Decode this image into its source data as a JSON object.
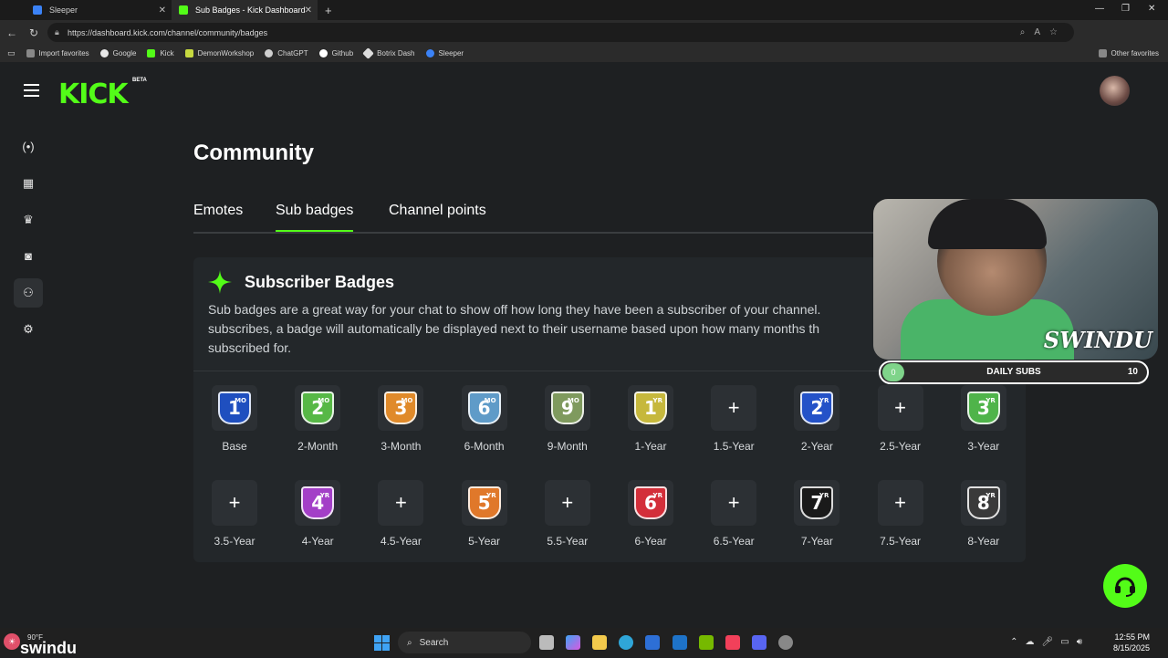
{
  "browser": {
    "tabs": [
      {
        "label": "Sleeper",
        "active": false
      },
      {
        "label": "Sub Badges - Kick Dashboard",
        "active": true
      }
    ],
    "url": "https://dashboard.kick.com/channel/community/badges",
    "bookmarks": [
      "Import favorites",
      "Google",
      "Kick",
      "DemonWorkshop",
      "ChatGPT",
      "Github",
      "Botrix Dash",
      "Sleeper"
    ],
    "other_favorites": "Other favorites"
  },
  "header": {
    "logo": "KICK",
    "beta": "BETA"
  },
  "page": {
    "title": "Community",
    "tabs": [
      {
        "label": "Emotes",
        "selected": false
      },
      {
        "label": "Sub badges",
        "selected": true
      },
      {
        "label": "Channel points",
        "selected": false
      }
    ]
  },
  "card": {
    "title": "Subscriber Badges",
    "desc_line1": "Sub badges are a great way for your chat to show off how long they have been a subscriber of your channel.",
    "desc_line2": "subscribes, a badge will automatically be displayed next to their username based upon how many months th",
    "desc_line3": "subscribed for."
  },
  "badges": [
    {
      "label": "Base",
      "num": "1",
      "unit": "MO",
      "color": "#1f4fbf",
      "set": true
    },
    {
      "label": "2-Month",
      "num": "2",
      "unit": "MO",
      "color": "#57b846",
      "set": true
    },
    {
      "label": "3-Month",
      "num": "3",
      "unit": "MO",
      "color": "#e08a2a",
      "set": true
    },
    {
      "label": "6-Month",
      "num": "6",
      "unit": "MO",
      "color": "#5f9bc8",
      "set": true
    },
    {
      "label": "9-Month",
      "num": "9",
      "unit": "MO",
      "color": "#7f9a5e",
      "set": true
    },
    {
      "label": "1-Year",
      "num": "1",
      "unit": "YR",
      "color": "#c6b83c",
      "set": true
    },
    {
      "label": "1.5-Year",
      "set": false
    },
    {
      "label": "2-Year",
      "num": "2",
      "unit": "YR",
      "color": "#2452c8",
      "set": true
    },
    {
      "label": "2.5-Year",
      "set": false
    },
    {
      "label": "3-Year",
      "num": "3",
      "unit": "YR",
      "color": "#4fb44a",
      "set": true
    },
    {
      "label": "3.5-Year",
      "set": false
    },
    {
      "label": "4-Year",
      "num": "4",
      "unit": "YR",
      "color": "#a33fc7",
      "set": true
    },
    {
      "label": "4.5-Year",
      "set": false
    },
    {
      "label": "5-Year",
      "num": "5",
      "unit": "YR",
      "color": "#e0782a",
      "set": true
    },
    {
      "label": "5.5-Year",
      "set": false
    },
    {
      "label": "6-Year",
      "num": "6",
      "unit": "YR",
      "color": "#d32f3a",
      "set": true
    },
    {
      "label": "6.5-Year",
      "set": false
    },
    {
      "label": "7-Year",
      "num": "7",
      "unit": "YR",
      "color": "#1a1a1a",
      "set": true
    },
    {
      "label": "7.5-Year",
      "set": false
    },
    {
      "label": "8-Year",
      "num": "8",
      "unit": "YR",
      "color": "#3a3a3a",
      "set": true
    }
  ],
  "overlay": {
    "streamer": "SWINDU",
    "subs_min": "0",
    "subs_label": "DAILY SUBS",
    "subs_max": "10",
    "daily_subs_value": 0
  },
  "taskbar": {
    "temp": "90°F",
    "channel": "swindu",
    "search": "Search",
    "time": "12:55 PM",
    "date": "8/15/2025"
  },
  "colors": {
    "accent": "#53fc18",
    "background": "#1e2022",
    "card": "#23272a"
  }
}
